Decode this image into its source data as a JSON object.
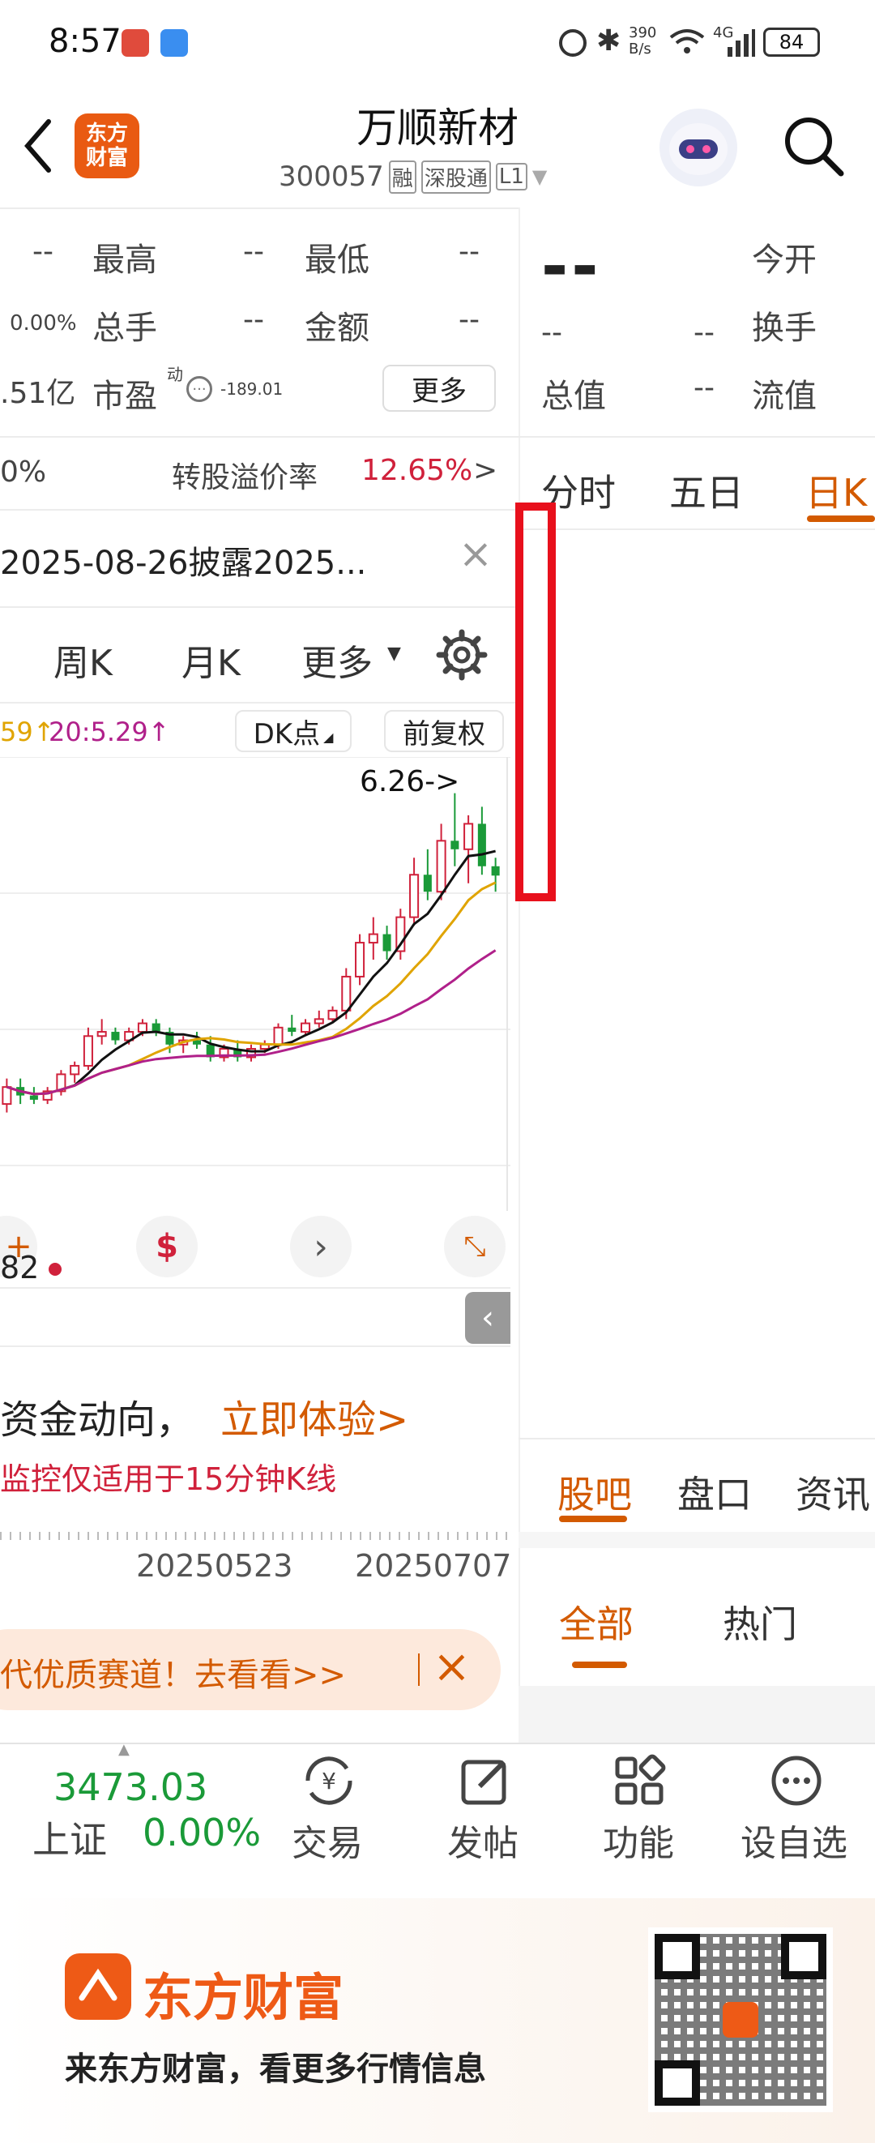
{
  "status_bar": {
    "time": "8:57",
    "net_speed_top": "390",
    "net_speed_bottom": "B/s",
    "signal": "4G",
    "battery": "84"
  },
  "header": {
    "logo_line1": "东方",
    "logo_line2": "财富",
    "title": "万顺新材",
    "code": "300057",
    "tag_rong": "融",
    "tag_sgt": "深股通",
    "tag_level": "L1"
  },
  "quote": {
    "high_label": "最高",
    "high_value": "--",
    "low_label": "最低",
    "low_value": "--",
    "vol_label": "总手",
    "vol_value": "--",
    "amount_label": "金额",
    "amount_value": "--",
    "pe_label": "市盈",
    "pe_sup": "动",
    "pe_small": "-189.01",
    "more_label": "更多",
    "left_dash_1": "--",
    "left_pct": "0.00%",
    "left_cap": ".51亿",
    "price_big": "--",
    "price_sub1": "--",
    "price_sub2": "--",
    "open_label": "今开",
    "open_value": "--",
    "turnover_label": "换手",
    "turnover_value": "--",
    "total_val_label": "总值",
    "total_val_value": "--",
    "float_val_label": "流值",
    "float_val_value": "--"
  },
  "conv": {
    "left": "0%",
    "label": "转股溢价率",
    "value": "12.65%",
    "arrow": ">"
  },
  "notice": {
    "text": "2025-08-26披露2025...",
    "close": "×"
  },
  "chart_tabs": {
    "left": [
      "周K",
      "月K",
      "更多"
    ],
    "right": [
      "分时",
      "五日",
      "日K"
    ]
  },
  "ma_legend": {
    "ma1": "59↑",
    "ma2": "20:5.29↑",
    "dk_label": "DK点",
    "adjust_label": "前复权"
  },
  "chart": {
    "peak_label": "6.26->",
    "left_num": "82",
    "dates": [
      "20250523",
      "20250707"
    ]
  },
  "promo": {
    "prefix": "资金动向，",
    "cta": "立即体验>",
    "note": "监控仅适用于15分钟K线"
  },
  "banner": {
    "text": "代优质赛道！去看看>>",
    "close": "×"
  },
  "bar_tabs": [
    "股吧",
    "盘口",
    "资讯"
  ],
  "sub_tabs": [
    "全部",
    "热门"
  ],
  "bottom_nav": {
    "index_value": "3473.03",
    "index_name": "上证",
    "index_pct": "0.00%",
    "items": [
      "交易",
      "发帖",
      "功能",
      "设自选"
    ]
  },
  "footer": {
    "brand": "东方财富",
    "slogan": "来东方财富，看更多行情信息"
  },
  "colors": {
    "accent": "#d35a00",
    "up": "#d0213b",
    "down": "#1a9a38",
    "highlight_box": "#e8101c"
  },
  "chart_data": {
    "type": "candlestick",
    "x": [
      "20250523",
      "20250707"
    ],
    "peak_annotation": "6.26->",
    "series": [
      {
        "name": "",
        "values": [
          5.29
        ]
      }
    ],
    "ohlc": [
      [
        2.6,
        2.9,
        2.5,
        2.8
      ],
      [
        2.8,
        2.9,
        2.6,
        2.7
      ],
      [
        2.7,
        2.8,
        2.6,
        2.65
      ],
      [
        2.65,
        2.8,
        2.6,
        2.75
      ],
      [
        2.75,
        3.0,
        2.7,
        2.95
      ],
      [
        2.95,
        3.1,
        2.85,
        3.05
      ],
      [
        3.05,
        3.5,
        3.0,
        3.4
      ],
      [
        3.4,
        3.6,
        3.3,
        3.45
      ],
      [
        3.45,
        3.5,
        3.3,
        3.35
      ],
      [
        3.35,
        3.5,
        3.3,
        3.45
      ],
      [
        3.45,
        3.6,
        3.4,
        3.55
      ],
      [
        3.55,
        3.6,
        3.4,
        3.45
      ],
      [
        3.45,
        3.5,
        3.2,
        3.3
      ],
      [
        3.3,
        3.4,
        3.2,
        3.35
      ],
      [
        3.35,
        3.45,
        3.25,
        3.3
      ],
      [
        3.3,
        3.4,
        3.1,
        3.15
      ],
      [
        3.15,
        3.3,
        3.1,
        3.25
      ],
      [
        3.25,
        3.35,
        3.1,
        3.15
      ],
      [
        3.15,
        3.3,
        3.1,
        3.25
      ],
      [
        3.25,
        3.35,
        3.2,
        3.3
      ],
      [
        3.3,
        3.55,
        3.25,
        3.5
      ],
      [
        3.5,
        3.65,
        3.4,
        3.45
      ],
      [
        3.45,
        3.6,
        3.4,
        3.55
      ],
      [
        3.55,
        3.7,
        3.5,
        3.6
      ],
      [
        3.6,
        3.75,
        3.55,
        3.7
      ],
      [
        3.7,
        4.2,
        3.6,
        4.1
      ],
      [
        4.1,
        4.6,
        4.0,
        4.5
      ],
      [
        4.5,
        4.8,
        4.3,
        4.6
      ],
      [
        4.6,
        4.7,
        4.3,
        4.4
      ],
      [
        4.4,
        4.9,
        4.3,
        4.8
      ],
      [
        4.8,
        5.5,
        4.7,
        5.3
      ],
      [
        5.3,
        5.6,
        5.0,
        5.1
      ],
      [
        5.1,
        5.9,
        5.0,
        5.7
      ],
      [
        5.7,
        6.26,
        5.4,
        5.6
      ],
      [
        5.6,
        6.0,
        5.2,
        5.9
      ],
      [
        5.9,
        6.1,
        5.3,
        5.4
      ],
      [
        5.4,
        5.5,
        5.1,
        5.29
      ]
    ]
  }
}
